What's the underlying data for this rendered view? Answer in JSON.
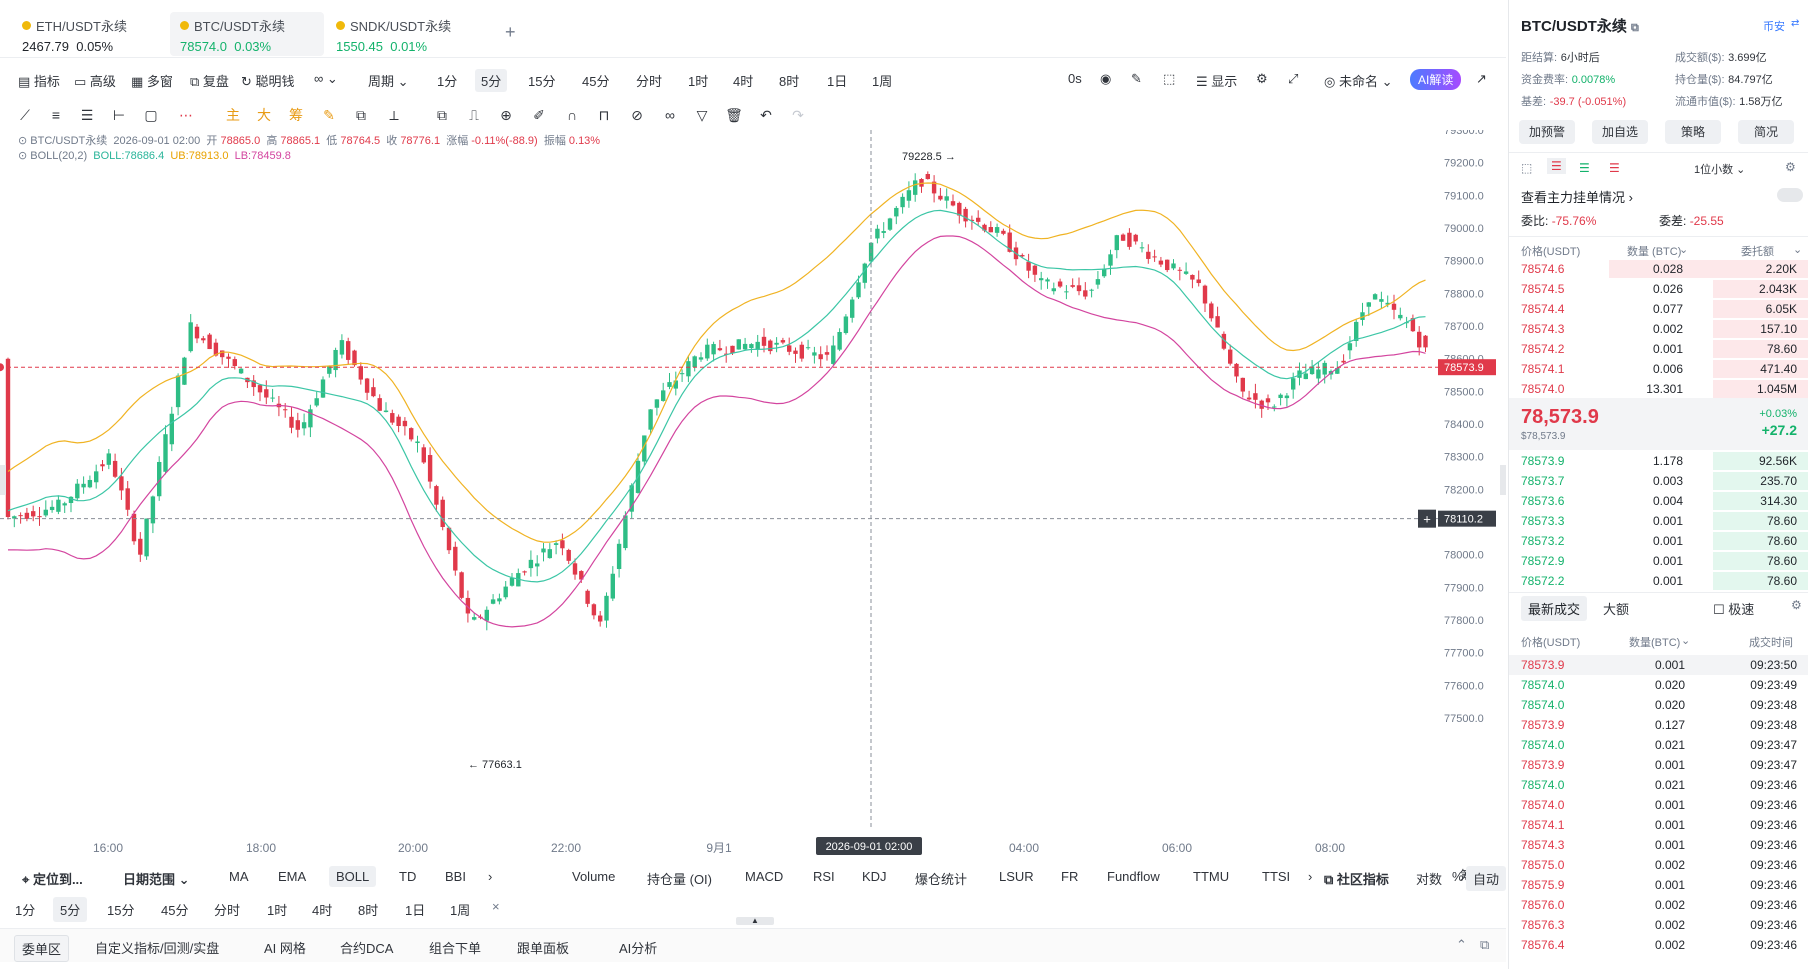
{
  "tabs": [
    {
      "name": "ETH/USDT永续",
      "price": "2467.79",
      "change": "0.05%",
      "color": "#1f2329"
    },
    {
      "name": "BTC/USDT永续",
      "price": "78574.0",
      "change": "0.03%",
      "color": "#13b26b"
    },
    {
      "name": "SNDK/USDT永续",
      "price": "1550.45",
      "change": "0.01%",
      "color": "#13b26b"
    }
  ],
  "tabs_add": "+",
  "toolbar": {
    "indicator": "指标",
    "advanced": "高级",
    "multi_window": "多窗",
    "replay": "复盘",
    "smart_money": "聪明钱",
    "period": "周期",
    "intervals": [
      "1分",
      "5分",
      "15分",
      "45分",
      "分时",
      "1时",
      "4时",
      "8时",
      "1日",
      "1周"
    ],
    "selected_interval": "5分",
    "countdown": "0s",
    "display": "显示",
    "unnamed": "未命名",
    "ai": "AI解读"
  },
  "legend": {
    "symbol": "BTC/USDT永续",
    "time": "2026-09-01 02:00",
    "open_label": "开",
    "open": "78865.0",
    "high_label": "高",
    "high": "78865.1",
    "low_label": "低",
    "low": "78764.5",
    "close_label": "收",
    "close": "78776.1",
    "chg_label": "涨幅",
    "chg": "-0.11%(-88.9)",
    "amp_label": "振幅",
    "amp": "0.13%",
    "boll_name": "BOLL(20,2)",
    "boll": "BOLL:78686.4",
    "ub": "UB:78913.0",
    "lb": "LB:78459.8"
  },
  "chart_data": {
    "type": "candlestick",
    "symbol": "BTC/USDT永续",
    "y_ticks": [
      79300.0,
      79200.0,
      79100.0,
      79000.0,
      78900.0,
      78800.0,
      78700.0,
      78600.0,
      78500.0,
      78400.0,
      78300.0,
      78200.0,
      78100.0,
      78000.0,
      77900.0,
      77800.0,
      77700.0,
      77600.0,
      77500.0
    ],
    "ylim": [
      77470,
      79320
    ],
    "x_ticks": [
      "16:00",
      "18:00",
      "20:00",
      "22:00",
      "9月1",
      "04:00",
      "06:00",
      "08:00"
    ],
    "crosshair_time": "2026-09-01 02:00",
    "last_price": "78573.9",
    "crosshair_price": "78110.2",
    "high_marker": "79228.5",
    "low_marker": "77663.1",
    "colors": {
      "up": "#2ebd85",
      "down": "#e0394a",
      "mid": "#3cc6a6",
      "ub": "#f0b323",
      "lb": "#d3459f"
    }
  },
  "bottom": {
    "locate": "定位到...",
    "date_range": "日期范围",
    "main_inds": [
      "MA",
      "EMA",
      "BOLL",
      "TD",
      "BBI"
    ],
    "main_sel": "BOLL",
    "sub_inds": [
      "Volume",
      "持仓量 (OI)",
      "MACD",
      "RSI",
      "KDJ",
      "爆仓统计",
      "LSUR",
      "FR",
      "Fundflow",
      "TTMU",
      "TTSI"
    ],
    "community": "社区指标",
    "log": "对数",
    "pct": "%",
    "auto": "自动",
    "intervals": [
      "1分",
      "5分",
      "15分",
      "45分",
      "分时",
      "1时",
      "4时",
      "8时",
      "1日",
      "1周"
    ],
    "sel": "5分",
    "panels": [
      "委单区",
      "自定义指标/回测/实盘",
      "AI 网格",
      "合约DCA",
      "组合下单",
      "跟单面板",
      "AI分析"
    ],
    "axis_labels": [
      "筹",
      "爆"
    ]
  },
  "right": {
    "title": "BTC/USDT永续",
    "exchange": "币安",
    "stats": [
      {
        "k": "距结算:",
        "v": "6小时后",
        "k2": "成交额($):",
        "v2": "3.699亿"
      },
      {
        "k": "资金费率:",
        "v": "0.0078%",
        "k2": "持仓量($):",
        "v2": "84.797亿"
      },
      {
        "k": "基差:",
        "v": "-39.7 (-0.051%)",
        "k2": "流通市值($):",
        "v2": "1.58万亿"
      }
    ],
    "buttons": [
      "加预警",
      "加自选",
      "策略",
      "简况"
    ],
    "decimals": "1位小数",
    "main_orders": "查看主力挂单情况",
    "ratio_label": "委比:",
    "ratio": "-75.76%",
    "diff_label": "委差:",
    "diff": "-25.55",
    "ob_headers": [
      "价格(USDT)",
      "数量 (BTC)",
      "委托额"
    ],
    "asks": [
      [
        "78574.6",
        "0.028",
        "2.20K"
      ],
      [
        "78574.5",
        "0.026",
        "2.043K"
      ],
      [
        "78574.4",
        "0.077",
        "6.05K"
      ],
      [
        "78574.3",
        "0.002",
        "157.10"
      ],
      [
        "78574.2",
        "0.001",
        "78.60"
      ],
      [
        "78574.1",
        "0.006",
        "471.40"
      ],
      [
        "78574.0",
        "13.301",
        "1.045M"
      ]
    ],
    "mid_price": "78,573.9",
    "mid_sub": "$78,573.9",
    "mid_pct": "+0.03%",
    "mid_chg": "+27.2",
    "bids": [
      [
        "78573.9",
        "1.178",
        "92.56K"
      ],
      [
        "78573.7",
        "0.003",
        "235.70"
      ],
      [
        "78573.6",
        "0.004",
        "314.30"
      ],
      [
        "78573.3",
        "0.001",
        "78.60"
      ],
      [
        "78573.2",
        "0.001",
        "78.60"
      ],
      [
        "78572.9",
        "0.001",
        "78.60"
      ],
      [
        "78572.2",
        "0.001",
        "78.60"
      ]
    ],
    "trade_tabs": [
      "最新成交",
      "大额"
    ],
    "fast": "极速",
    "trade_headers": [
      "价格(USDT)",
      "数量(BTC)",
      "成交时间"
    ],
    "trades": [
      [
        "78573.9",
        "0.001",
        "09:23:50",
        "r"
      ],
      [
        "78574.0",
        "0.020",
        "09:23:49",
        "g"
      ],
      [
        "78574.0",
        "0.020",
        "09:23:48",
        "g"
      ],
      [
        "78573.9",
        "0.127",
        "09:23:48",
        "r"
      ],
      [
        "78574.0",
        "0.021",
        "09:23:47",
        "g"
      ],
      [
        "78573.9",
        "0.001",
        "09:23:47",
        "r"
      ],
      [
        "78574.0",
        "0.021",
        "09:23:46",
        "g"
      ],
      [
        "78574.0",
        "0.001",
        "09:23:46",
        "r"
      ],
      [
        "78574.1",
        "0.001",
        "09:23:46",
        "r"
      ],
      [
        "78574.3",
        "0.001",
        "09:23:46",
        "r"
      ],
      [
        "78575.0",
        "0.002",
        "09:23:46",
        "r"
      ],
      [
        "78575.9",
        "0.001",
        "09:23:46",
        "r"
      ],
      [
        "78576.0",
        "0.002",
        "09:23:46",
        "r"
      ],
      [
        "78576.3",
        "0.002",
        "09:23:46",
        "r"
      ],
      [
        "78576.4",
        "0.002",
        "09:23:46",
        "r"
      ]
    ]
  }
}
